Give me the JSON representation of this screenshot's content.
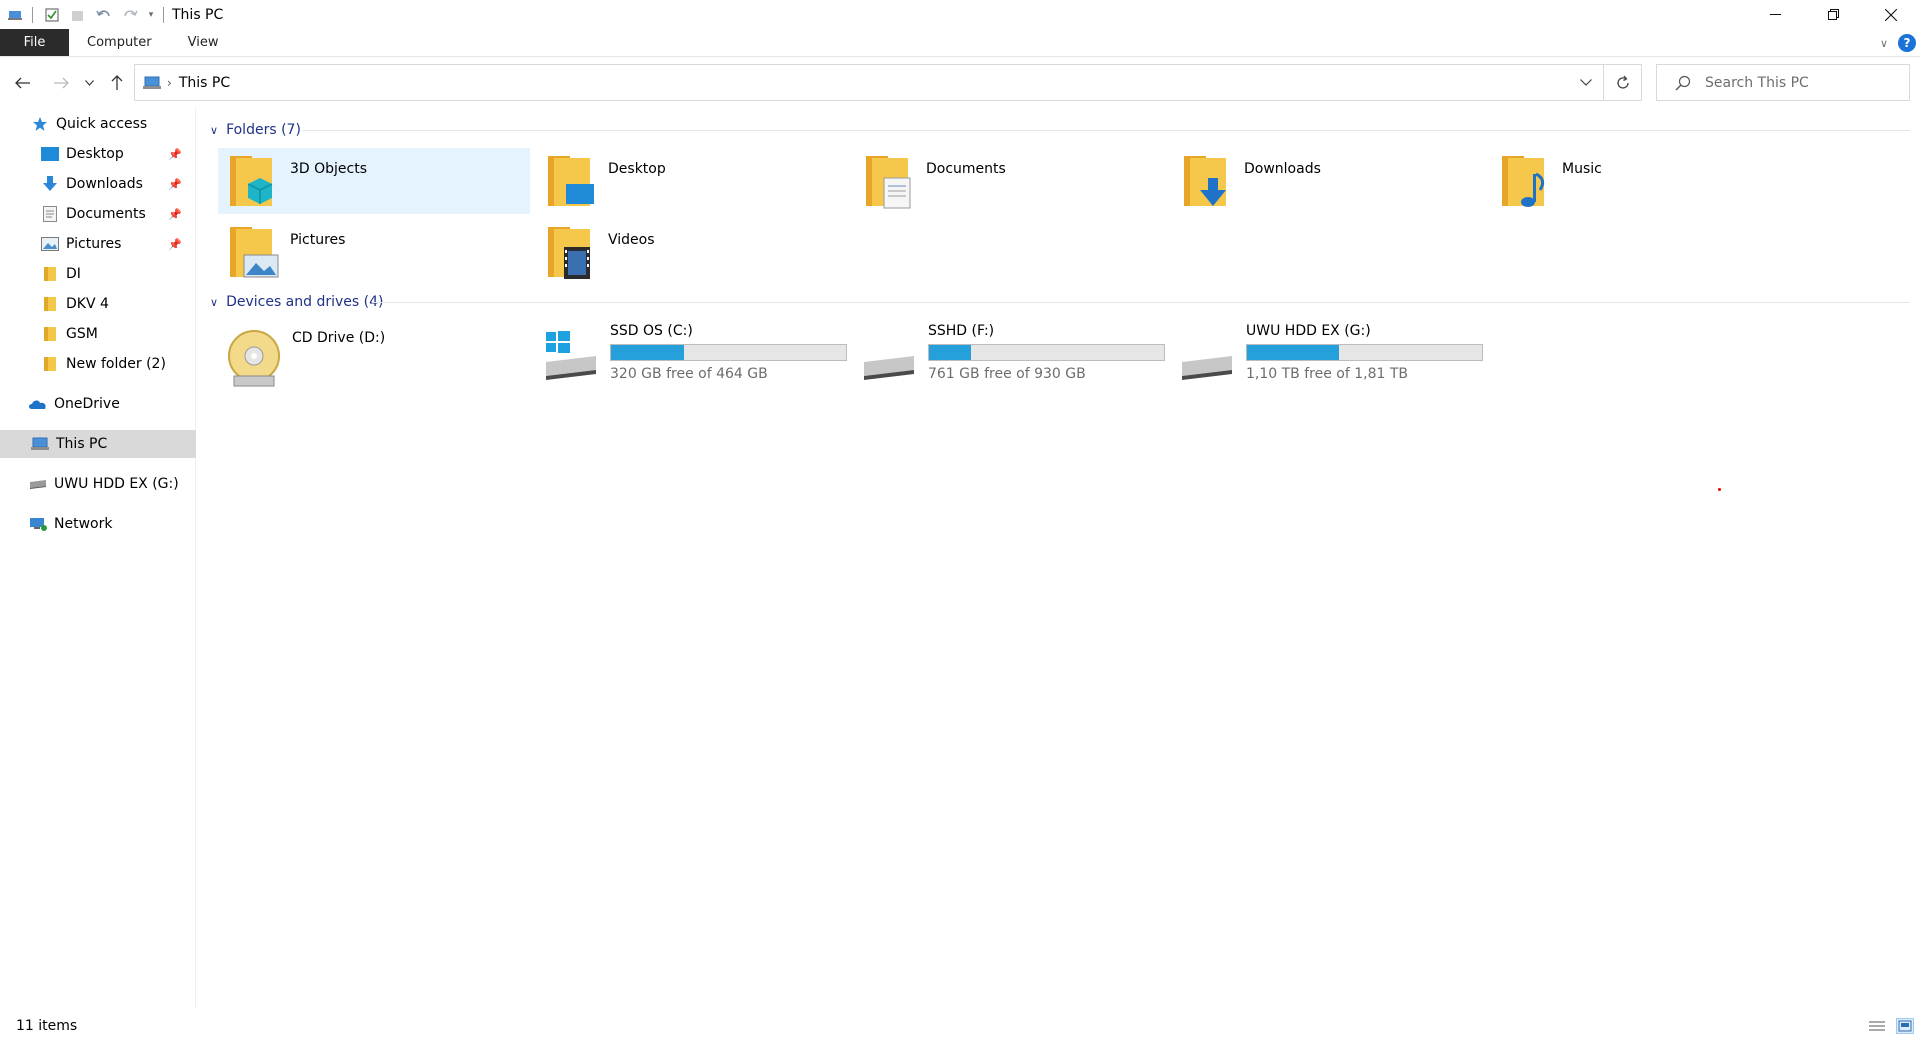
{
  "window": {
    "title": "This PC"
  },
  "ribbon": {
    "tabs": [
      "File",
      "Computer",
      "View"
    ],
    "help_label": "?"
  },
  "address": {
    "path": "This PC"
  },
  "search": {
    "placeholder": "Search This PC"
  },
  "sidebar": {
    "quick_access": "Quick access",
    "pinned": [
      {
        "label": "Desktop",
        "icon": "desktop-icon"
      },
      {
        "label": "Downloads",
        "icon": "downloads-icon"
      },
      {
        "label": "Documents",
        "icon": "documents-icon"
      },
      {
        "label": "Pictures",
        "icon": "pictures-icon"
      }
    ],
    "folders": [
      "DI",
      "DKV 4",
      "GSM",
      "New folder (2)"
    ],
    "onedrive": "OneDrive",
    "this_pc": "This PC",
    "external": "UWU HDD EX (G:)",
    "network": "Network"
  },
  "groups": {
    "folders": {
      "title": "Folders (7)",
      "items": [
        "3D Objects",
        "Desktop",
        "Documents",
        "Downloads",
        "Music",
        "Pictures",
        "Videos"
      ]
    },
    "drives": {
      "title": "Devices and drives (4)",
      "items": [
        {
          "name": "CD Drive (D:)"
        },
        {
          "name": "SSD OS (C:)",
          "free": "320 GB free of 464 GB",
          "used_fraction": 0.31
        },
        {
          "name": "SSHD (F:)",
          "free": "761 GB free of 930 GB",
          "used_fraction": 0.18
        },
        {
          "name": "UWU HDD EX (G:)",
          "free": "1,10 TB free of 1,81 TB",
          "used_fraction": 0.39
        }
      ]
    }
  },
  "status": {
    "count": "11 items"
  },
  "colors": {
    "accent": "#26a0da",
    "group_header": "#1e3287",
    "selection": "#e5f3ff",
    "file_tab": "#2b2b2b"
  }
}
